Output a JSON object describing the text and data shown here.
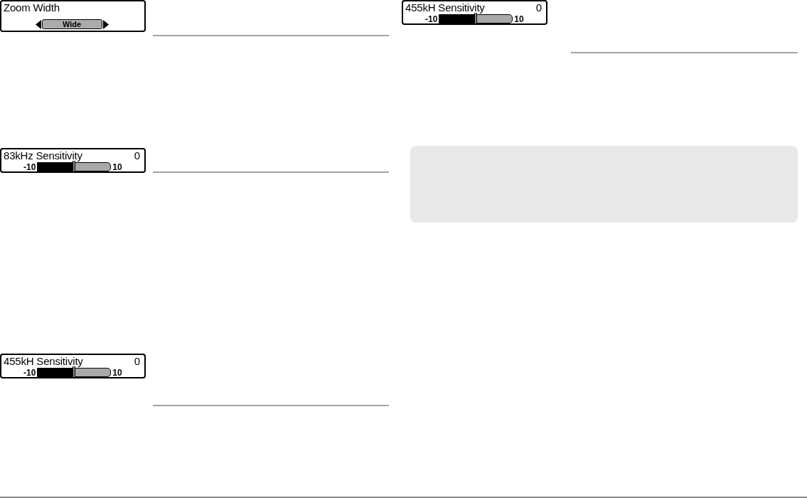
{
  "left_column": {
    "menus": [
      {
        "kind": "selector",
        "title": "Zoom Width",
        "value": "Wide"
      },
      {
        "kind": "slider",
        "title": "83kHz Sensitivity",
        "reading": "0",
        "min_label": "-10",
        "max_label": "10",
        "level": 0.5
      },
      {
        "kind": "slider",
        "title": "455kH Sensitivity",
        "reading": "0",
        "min_label": "-10",
        "max_label": "10",
        "level": 0.5
      }
    ]
  },
  "right_column": {
    "menus": [
      {
        "kind": "slider",
        "title": "455kH Sensitivity",
        "reading": "0",
        "min_label": "-10",
        "max_label": "10",
        "level": 0.5
      }
    ]
  }
}
